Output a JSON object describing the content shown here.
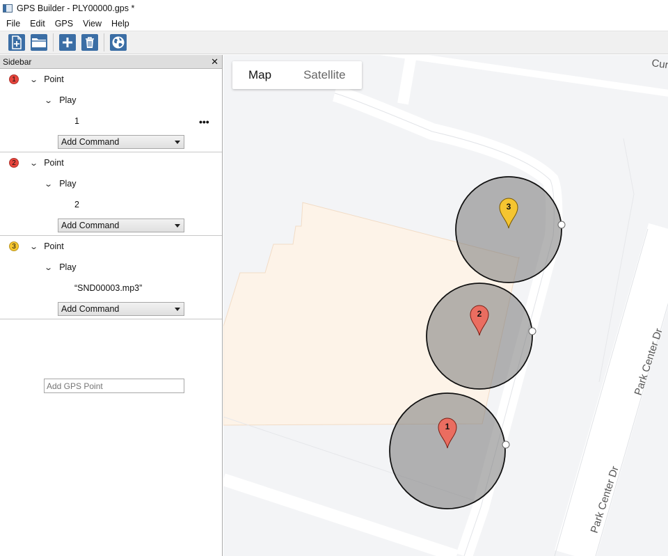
{
  "window": {
    "title": "GPS Builder - PLY00000.gps *"
  },
  "menu": [
    "File",
    "Edit",
    "GPS",
    "View",
    "Help"
  ],
  "toolbar": {
    "buttons": [
      "new-file-icon",
      "open-folder-icon",
      "add-icon",
      "delete-icon",
      "globe-icon"
    ]
  },
  "sidebar": {
    "title": "Sidebar",
    "close": "✕",
    "points": [
      {
        "number": "1",
        "color": "#e8453c",
        "label": "Point",
        "group": "Play",
        "value": "1",
        "has_more": true,
        "more": "•••",
        "command": "Add Command"
      },
      {
        "number": "2",
        "color": "#e8453c",
        "label": "Point",
        "group": "Play",
        "value": "2",
        "has_more": false,
        "command": "Add Command"
      },
      {
        "number": "3",
        "color": "#f7c72e",
        "label": "Point",
        "group": "Play",
        "value": "“SND00003.mp3”",
        "has_more": false,
        "command": "Add Command"
      }
    ],
    "add_point_placeholder": "Add GPS Point"
  },
  "map": {
    "tabs": {
      "map": "Map",
      "satellite": "Satellite"
    },
    "streets": {
      "cur": "Cur",
      "park_center_1": "Park Center Dr",
      "park_center_2": "Park Center Dr"
    },
    "markers": [
      {
        "number": "1",
        "color": "#ea6d60"
      },
      {
        "number": "2",
        "color": "#ea6d60"
      },
      {
        "number": "3",
        "color": "#f5c531"
      }
    ]
  }
}
